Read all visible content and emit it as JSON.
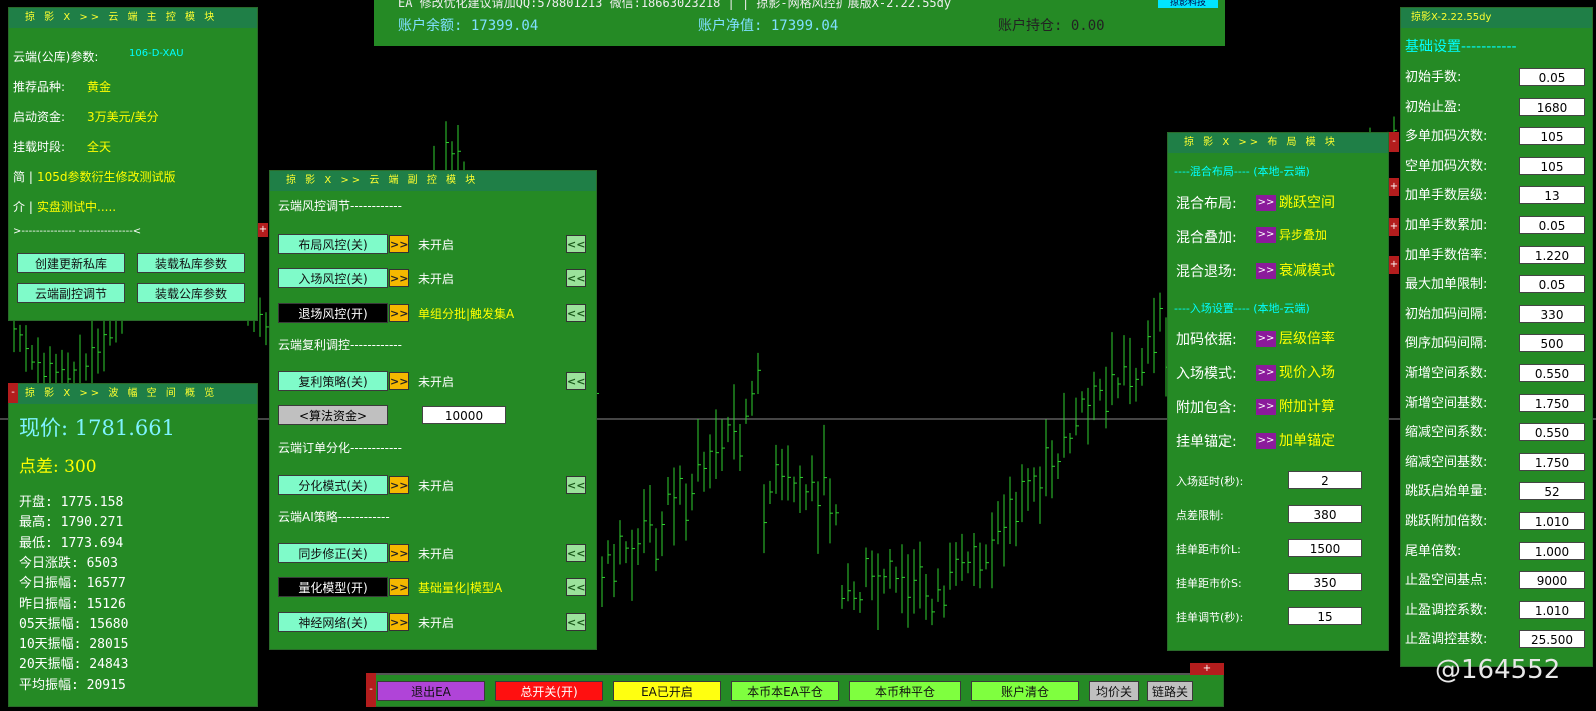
{
  "header": {
    "line1": "EA  修改优化建议请加QQ:578801213  微信:18663023218 |                 | 掠影-网格风控扩展版X-2.22.55dy",
    "balance": "账户余额: 17399.04",
    "equity": "账户净值: 17399.04",
    "position": "账户持仓: 0.00",
    "badge": "掠影科技"
  },
  "main": {
    "title": "掠 影 X >> 云 端 主 控 模 块",
    "rows": [
      {
        "label": "云端(公库)参数:",
        "value": "106-D-XAU"
      },
      {
        "label": "推荐品种:",
        "value": "黄金"
      },
      {
        "label": "启动资金:",
        "value": "3万美元/美分"
      },
      {
        "label": "挂载时段:",
        "value": "全天"
      },
      {
        "label": "简 |",
        "value": "105d参数衍生修改测试版"
      },
      {
        "label": "介 |",
        "value": "实盘测试中....."
      }
    ],
    "divider": ">---------------     ---------------<",
    "buttons": [
      "创建更新私库",
      "装载私库参数",
      "云端副控调节",
      "装载公库参数"
    ]
  },
  "overview": {
    "title": "掠 影 X >> 波 幅 空 间 概 览",
    "price": "现价: 1781.661",
    "spread": "点差: 300",
    "stats": [
      "开盘: 1775.158",
      "最高: 1790.271",
      "最低: 1773.694",
      "今日涨跌: 6503",
      "今日振幅: 16577",
      "昨日振幅: 15126",
      "05天振幅: 15680",
      "10天振幅: 28015",
      "20天振幅: 24843",
      "平均振幅: 20915"
    ]
  },
  "sub": {
    "title": "掠 影 X >> 云 端 副 控 模 块",
    "s1": "云端风控调节------------",
    "s2": "云端复利调控------------",
    "s3": "云端订单分化------------",
    "s4": "云端AI策略------------",
    "items": [
      {
        "btn": "布局风控(关)",
        "status": "未开启"
      },
      {
        "btn": "入场风控(关)",
        "status": "未开启"
      },
      {
        "btn": "退场风控(开)",
        "status": "单组分批|触发集A"
      },
      {
        "btn": "复利策略(关)",
        "status": "未开启"
      },
      {
        "btn": "分化模式(关)",
        "status": "未开启"
      },
      {
        "btn": "同步修正(关)",
        "status": "未开启"
      },
      {
        "btn": "量化模型(开)",
        "status": "基础量化|模型A"
      },
      {
        "btn": "神经网络(关)",
        "status": "未开启"
      }
    ],
    "calc_btn": "<算法资金>",
    "calc_value": "10000",
    "arrow": ">>",
    "back": "<<"
  },
  "layout": {
    "title": "掠 影 X >> 布 局 模 块",
    "sec1": "----混合布局---- (本地-云端)",
    "sec2": "----入场设置---- (本地-云端)",
    "modes": [
      {
        "label": "混合布局:",
        "value": "跳跃空间"
      },
      {
        "label": "混合叠加:",
        "value": "异步叠加"
      },
      {
        "label": "混合退场:",
        "value": "衰减模式"
      },
      {
        "label": "加码依据:",
        "value": "层级倍率"
      },
      {
        "label": "入场模式:",
        "value": "现价入场"
      },
      {
        "label": "附加包含:",
        "value": "附加计算"
      },
      {
        "label": "挂单锚定:",
        "value": "加单锚定"
      }
    ],
    "fields": [
      {
        "label": "入场延时(秒):",
        "value": "2"
      },
      {
        "label": "点差限制:",
        "value": "380"
      },
      {
        "label": "挂单距市价L:",
        "value": "1500"
      },
      {
        "label": "挂单距市价S:",
        "value": "350"
      },
      {
        "label": "挂单调节(秒):",
        "value": "15"
      }
    ]
  },
  "basic": {
    "title": "掠影X-2.22.55dy",
    "section": "基础设置-----------",
    "fields": [
      {
        "label": "初始手数:",
        "value": "0.05"
      },
      {
        "label": "初始止盈:",
        "value": "1680"
      },
      {
        "label": "多单加码次数:",
        "value": "105"
      },
      {
        "label": "空单加码次数:",
        "value": "105"
      },
      {
        "label": "加单手数层级:",
        "value": "13"
      },
      {
        "label": "加单手数累加:",
        "value": "0.05"
      },
      {
        "label": "加单手数倍率:",
        "value": "1.220"
      },
      {
        "label": "最大加单限制:",
        "value": "0.05"
      },
      {
        "label": "初始加码间隔:",
        "value": "330"
      },
      {
        "label": "倒序加码间隔:",
        "value": "500"
      },
      {
        "label": "渐增空间系数:",
        "value": "0.550"
      },
      {
        "label": "渐增空间基数:",
        "value": "1.750"
      },
      {
        "label": "缩减空间系数:",
        "value": "0.550"
      },
      {
        "label": "缩减空间基数:",
        "value": "1.750"
      },
      {
        "label": "跳跃启始单量:",
        "value": "52"
      },
      {
        "label": "跳跃附加倍数:",
        "value": "1.010"
      },
      {
        "label": "尾单倍数:",
        "value": "1.000"
      },
      {
        "label": "止盈空间基点:",
        "value": "9000"
      },
      {
        "label": "止盈调控系数:",
        "value": "1.010"
      },
      {
        "label": "止盈调控基数:",
        "value": "25.500"
      }
    ]
  },
  "bottom": {
    "buttons": [
      {
        "label": "退出EA",
        "color": "#b044d8"
      },
      {
        "label": "总开关(开)",
        "color": "#ff1010"
      },
      {
        "label": "EA已开启",
        "color": "#ffff10"
      },
      {
        "label": "本币本EA平仓",
        "color": "#7fff3f"
      },
      {
        "label": "本币种平仓",
        "color": "#7fff3f"
      },
      {
        "label": "账户清仓",
        "color": "#7fff3f"
      },
      {
        "label": "均价关",
        "color": "#c0c0c0"
      },
      {
        "label": "链路关",
        "color": "#c0c0c0"
      }
    ]
  },
  "tabs": {
    "minus": "-",
    "plus": "+"
  },
  "watermark": "@164552"
}
